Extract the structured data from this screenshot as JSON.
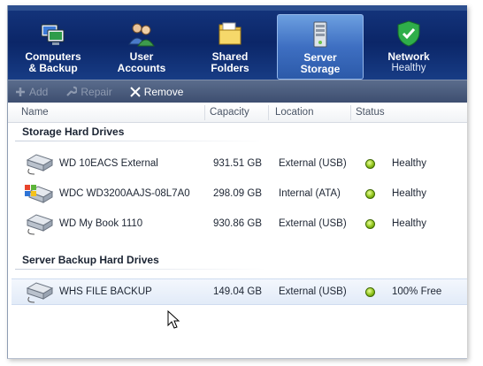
{
  "nav": {
    "tabs": [
      {
        "label": "Computers\n& Backup",
        "icon": "computers-icon",
        "active": false
      },
      {
        "label": "User\nAccounts",
        "icon": "users-icon",
        "active": false
      },
      {
        "label": "Shared\nFolders",
        "icon": "folder-icon",
        "active": false
      },
      {
        "label": "Server\nStorage",
        "icon": "server-icon",
        "active": true
      },
      {
        "label": "Network",
        "sublabel": "Healthy",
        "icon": "shield-check-icon",
        "active": false
      }
    ]
  },
  "toolbar": {
    "add_label": "Add",
    "repair_label": "Repair",
    "remove_label": "Remove"
  },
  "columns": [
    "Name",
    "Capacity",
    "Location",
    "Status"
  ],
  "groups": [
    {
      "title": "Storage Hard Drives",
      "rows": [
        {
          "name": "WD 10EACS External",
          "capacity": "931.51 GB",
          "location": "External (USB)",
          "status": "Healthy",
          "icon": "external-drive-icon"
        },
        {
          "name": "WDC WD3200AAJS-08L7A0",
          "capacity": "298.09 GB",
          "location": "Internal (ATA)",
          "status": "Healthy",
          "icon": "system-drive-icon"
        },
        {
          "name": "WD My Book 1110",
          "capacity": "930.86 GB",
          "location": "External (USB)",
          "status": "Healthy",
          "icon": "external-drive-icon"
        }
      ]
    },
    {
      "title": "Server Backup Hard Drives",
      "rows": [
        {
          "name": "WHS FILE BACKUP",
          "capacity": "149.04 GB",
          "location": "External (USB)",
          "status": "100% Free",
          "icon": "external-drive-icon",
          "selected": true
        }
      ]
    }
  ],
  "colors": {
    "nav_bg": "#0b2668",
    "active_tab": "#3e6fc2",
    "toolbar_bg": "#3d4e70",
    "status_ok": "#8fc21a"
  }
}
